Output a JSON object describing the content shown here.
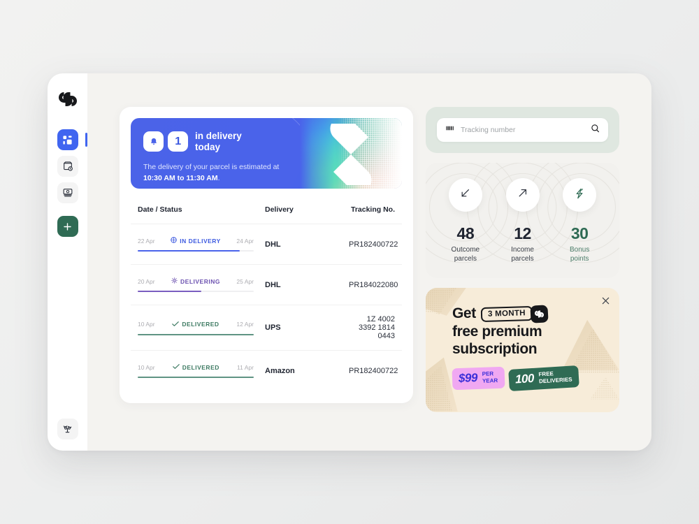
{
  "brand": {
    "logo_icon": "parcel-brand-logo"
  },
  "sidebar": {
    "items": [
      {
        "name": "dashboard",
        "icon": "grid-icon",
        "active": true
      },
      {
        "name": "parcels",
        "icon": "package-clock-icon",
        "active": false
      },
      {
        "name": "archive",
        "icon": "box-stack-icon",
        "active": false
      },
      {
        "name": "add",
        "icon": "plus-icon",
        "active": false
      }
    ],
    "bottom_item": {
      "name": "support",
      "icon": "desk-lamp-icon"
    }
  },
  "banner": {
    "count": "1",
    "bell_icon": "bell-icon",
    "headline_line1": "in delivery",
    "headline_line2": "today",
    "sub_prefix": "The delivery of your parcel is",
    "sub_middle": "estimated at ",
    "sub_time": "10:30 AM to 11:30 AM",
    "sub_suffix": ".",
    "bg_color": "#4a63ea"
  },
  "table": {
    "headers": {
      "date_status": "Date / Status",
      "delivery": "Delivery",
      "tracking": "Tracking No."
    },
    "rows": [
      {
        "start_date": "22 Apr",
        "end_date": "24 Apr",
        "status": "IN DELIVERY",
        "status_color": "#3d5ae0",
        "status_icon": "in-delivery-icon",
        "progress": 88,
        "carrier": "DHL",
        "tracking": "PR182400722"
      },
      {
        "start_date": "20 Apr",
        "end_date": "25 Apr",
        "status": "DELIVERING",
        "status_color": "#6c52b0",
        "status_icon": "delivering-icon",
        "progress": 55,
        "carrier": "DHL",
        "tracking": "PR184022080"
      },
      {
        "start_date": "10 Apr",
        "end_date": "12 Apr",
        "status": "DELIVERED",
        "status_color": "#3d7a62",
        "status_icon": "check-icon",
        "progress": 100,
        "carrier": "UPS",
        "tracking": "1Z 4002 3392 1814 0443"
      },
      {
        "start_date": "10 Apr",
        "end_date": "11 Apr",
        "status": "DELIVERED",
        "status_color": "#3d7a62",
        "status_icon": "check-icon",
        "progress": 100,
        "carrier": "Amazon",
        "tracking": "PR182400722"
      }
    ]
  },
  "search": {
    "placeholder": "Tracking number",
    "value": "",
    "barcode_icon": "barcode-icon",
    "search_icon": "search-icon",
    "card_bg": "#dfe7e0"
  },
  "stats": [
    {
      "icon": "arrow-down-left-icon",
      "value": "48",
      "label_line1": "Outcome",
      "label_line2": "parcels",
      "accent": "#1f2430"
    },
    {
      "icon": "arrow-up-right-icon",
      "value": "12",
      "label_line1": "Income",
      "label_line2": "parcels",
      "accent": "#1f2430"
    },
    {
      "icon": "lightning-bolt-icon",
      "value": "30",
      "label_line1": "Bonus",
      "label_line2": "points",
      "accent": "#2f6b54"
    }
  ],
  "promo": {
    "close_icon": "close-icon",
    "get_label": "Get",
    "duration_badge": "3 MONTH",
    "logo_icon": "parcel-brand-logo",
    "line2": "free premium",
    "line3": "subscription",
    "price_tag": {
      "price": "$99",
      "sub_line1": "PER",
      "sub_line2": "YEAR",
      "bg": "#f0a8f2",
      "fg": "#3a2fd8"
    },
    "deliveries_tag": {
      "count": "100",
      "sub_line1": "FREE",
      "sub_line2": "DELIVERIES",
      "bg": "#2f6b54",
      "fg": "#ffffff"
    },
    "bg": "#f7ecd9"
  }
}
